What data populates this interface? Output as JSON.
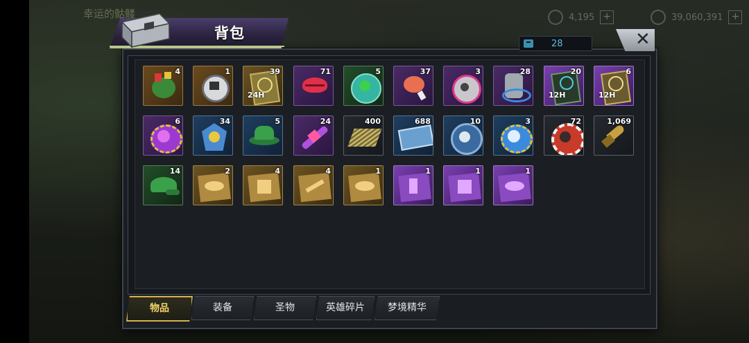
{
  "hud": {
    "title": "幸运的骷髅",
    "resource1": "4,195",
    "resource2": "39,060,391"
  },
  "panel": {
    "title": "背包",
    "capacity": "28",
    "close_label": "✕"
  },
  "tabs": [
    {
      "label": "物品",
      "active": true
    },
    {
      "label": "装备",
      "active": false
    },
    {
      "label": "圣物",
      "active": false
    },
    {
      "label": "英雄碎片",
      "active": false
    },
    {
      "label": "梦境精华",
      "active": false
    }
  ],
  "items": [
    {
      "count": "4",
      "icon": "holiday-gift-pile-icon",
      "quality": "orange"
    },
    {
      "count": "1",
      "icon": "fantasy-badge-icon",
      "quality": "orange"
    },
    {
      "count": "39",
      "icon": "gold-card-24h-icon",
      "quality": "gold",
      "tag": "24H"
    },
    {
      "count": "71",
      "icon": "red-lips-icon",
      "quality": "purple"
    },
    {
      "count": "5",
      "icon": "clover-coin-icon",
      "quality": "green"
    },
    {
      "count": "37",
      "icon": "meat-icon",
      "quality": "purple"
    },
    {
      "count": "3",
      "icon": "film-reel-icon",
      "quality": "purple"
    },
    {
      "count": "28",
      "icon": "mechanical-device-icon",
      "quality": "purple"
    },
    {
      "count": "20",
      "icon": "timer-card-12h-icon",
      "quality": "violet",
      "tag": "12H"
    },
    {
      "count": "6",
      "icon": "gold-card-12h-icon",
      "quality": "violet",
      "tag": "12H"
    },
    {
      "count": "6",
      "icon": "purple-bottle-cap-icon",
      "quality": "purple"
    },
    {
      "count": "34",
      "icon": "police-badge-icon",
      "quality": "blue"
    },
    {
      "count": "5",
      "icon": "green-hat-icon",
      "quality": "blue"
    },
    {
      "count": "24",
      "icon": "syringe-icon",
      "quality": "purple"
    },
    {
      "count": "400",
      "icon": "gold-bars-icon",
      "quality": "dark"
    },
    {
      "count": "688",
      "icon": "cinema-ticket-icon",
      "quality": "blue"
    },
    {
      "count": "10",
      "icon": "blue-token-icon",
      "quality": "blue"
    },
    {
      "count": "3",
      "icon": "blue-bottle-cap-icon",
      "quality": "blue"
    },
    {
      "count": "72",
      "icon": "poker-chip-icon",
      "quality": "dark"
    },
    {
      "count": "1,069",
      "icon": "bullet-icon",
      "quality": "dark"
    },
    {
      "count": "14",
      "icon": "green-cap-icon",
      "quality": "green"
    },
    {
      "count": "2",
      "icon": "gold-equip-hat-icon",
      "quality": "gold"
    },
    {
      "count": "4",
      "icon": "gold-equip-shirt-icon",
      "quality": "gold"
    },
    {
      "count": "4",
      "icon": "gold-equip-weapon-icon",
      "quality": "gold"
    },
    {
      "count": "1",
      "icon": "gold-equip-cap-icon",
      "quality": "gold"
    },
    {
      "count": "1",
      "icon": "purple-equip-boots-icon",
      "quality": "violet"
    },
    {
      "count": "1",
      "icon": "purple-equip-shirt-icon",
      "quality": "violet"
    },
    {
      "count": "1",
      "icon": "purple-equip-hat-icon",
      "quality": "violet"
    }
  ]
}
